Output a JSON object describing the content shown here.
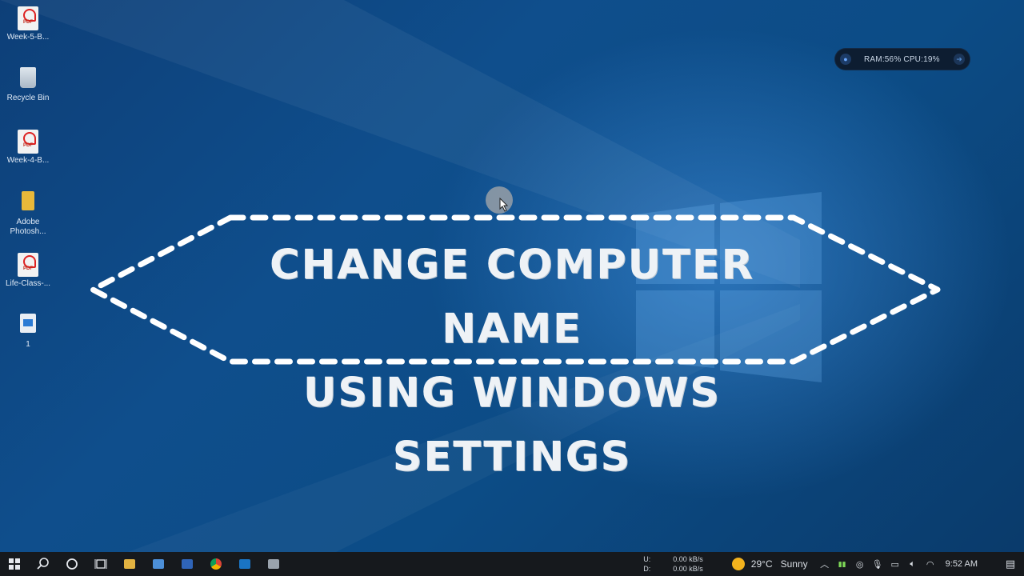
{
  "desktop": {
    "icons": [
      {
        "label": "Week-5-B...",
        "icon": "pdf-icon"
      },
      {
        "label": "Recycle Bin",
        "icon": "recycle-bin-icon"
      },
      {
        "label": "Week-4-B...",
        "icon": "pdf-icon"
      },
      {
        "label": "Adobe Photosh...",
        "icon": "folder-icon"
      },
      {
        "label": "Life-Class-...",
        "icon": "pdf-icon"
      },
      {
        "label": "1",
        "icon": "app-file-icon"
      }
    ]
  },
  "widget": {
    "stats": "RAM:56%  CPU:19%"
  },
  "banner": {
    "line1": "CHANGE COMPUTER NAME",
    "line2": "USING WINDOWS SETTINGS"
  },
  "taskbar": {
    "apps": [
      "start-icon",
      "search-icon",
      "cortana-icon",
      "task-view-icon",
      "file-explorer-icon",
      "mail-icon",
      "word-icon",
      "chrome-icon",
      "outlook-icon",
      "app-icon"
    ],
    "network": {
      "up_label": "U:",
      "down_label": "D:",
      "up_value": "0.00 kB/s",
      "down_value": "0.00 kB/s"
    },
    "weather": {
      "temp": "29°C",
      "condition": "Sunny"
    },
    "clock": "9:52 AM"
  },
  "colors": {
    "desktop_bg": "#0f4e8c",
    "taskbar_bg": "#16191d",
    "banner_stroke": "#ffffff"
  }
}
